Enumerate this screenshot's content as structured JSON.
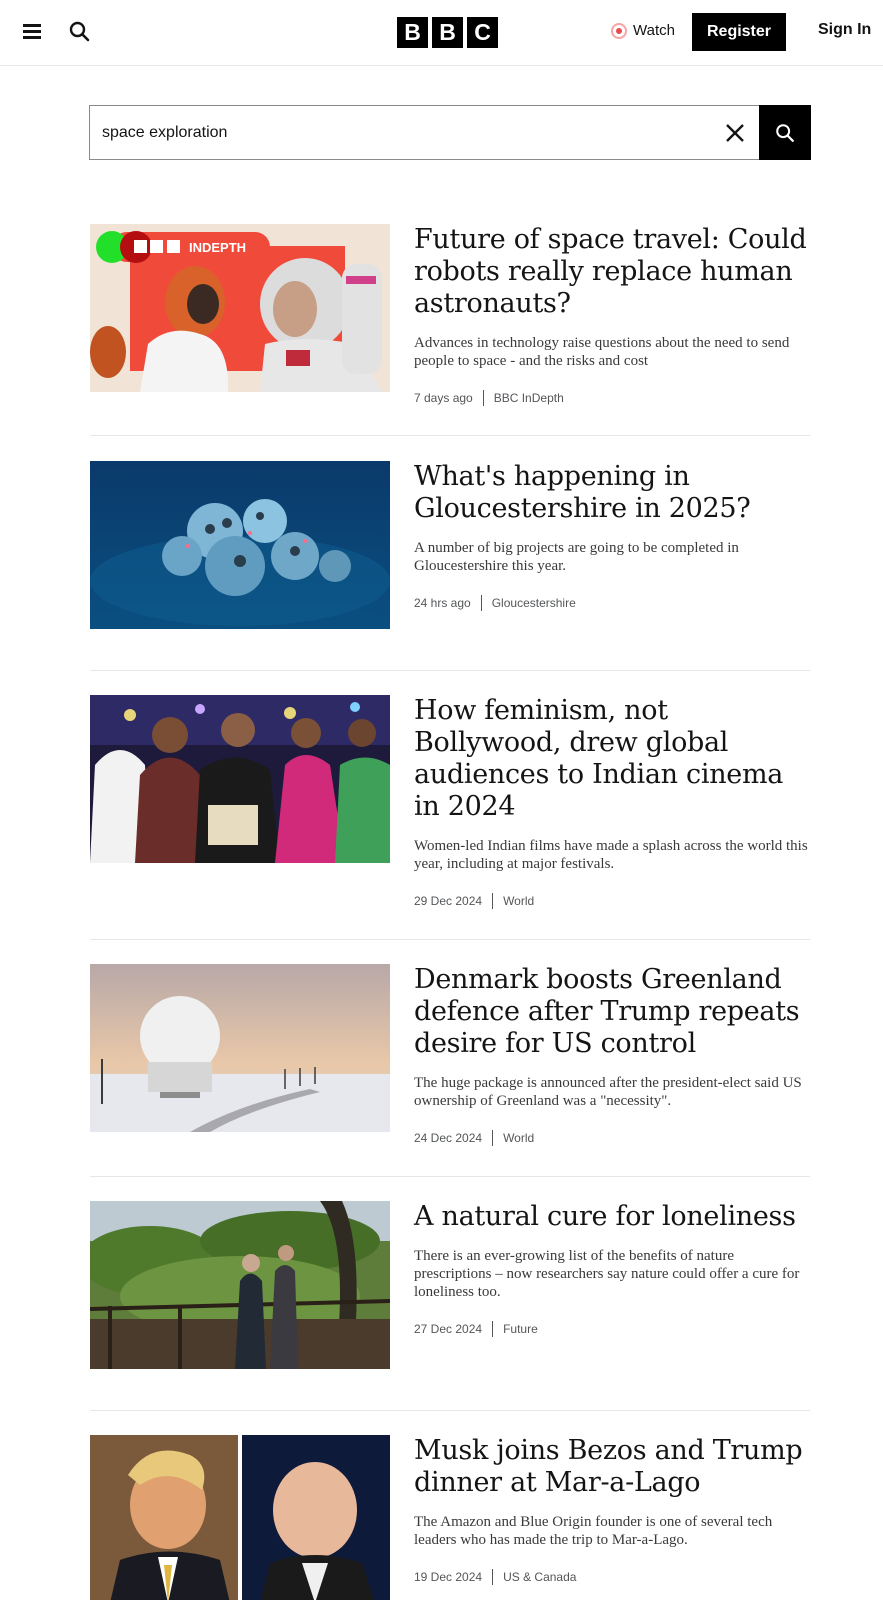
{
  "header": {
    "logo_letters": [
      "B",
      "B",
      "C"
    ],
    "watch_label": "Watch",
    "register_label": "Register",
    "signin_label": "Sign In"
  },
  "search": {
    "value": "space exploration"
  },
  "results": [
    {
      "badge": "INDEPTH",
      "title": "Future of space travel: Could robots really replace human astronauts?",
      "summary": "Advances in technology raise questions about the need to send people to space - and the risks and cost",
      "time": "7 days ago",
      "topic": "BBC InDepth"
    },
    {
      "title": "What's happening in Gloucestershire in 2025?",
      "summary": "A number of big projects are going to be completed in Gloucestershire this year.",
      "time": "24 hrs ago",
      "topic": "Gloucestershire"
    },
    {
      "title": "How feminism, not Bollywood, drew global audiences to Indian cinema in 2024",
      "summary": "Women-led Indian films have made a splash across the world this year, including at major festivals.",
      "time": "29 Dec 2024",
      "topic": "World"
    },
    {
      "title": "Denmark boosts Greenland defence after Trump repeats desire for US control",
      "summary": "The huge package is announced after the president-elect said US ownership of Greenland was a \"necessity\".",
      "time": "24 Dec 2024",
      "topic": "World"
    },
    {
      "title": "A natural cure for loneliness",
      "summary": "There is an ever-growing list of the benefits of nature prescriptions – now researchers say nature could offer a cure for loneliness too.",
      "time": "27 Dec 2024",
      "topic": "Future"
    },
    {
      "title": "Musk joins Bezos and Trump dinner at Mar-a-Lago",
      "summary": "The Amazon and Blue Origin founder is one of several tech leaders who has made the trip to Mar-a-Lago.",
      "time": "19 Dec 2024",
      "topic": "US & Canada"
    }
  ]
}
